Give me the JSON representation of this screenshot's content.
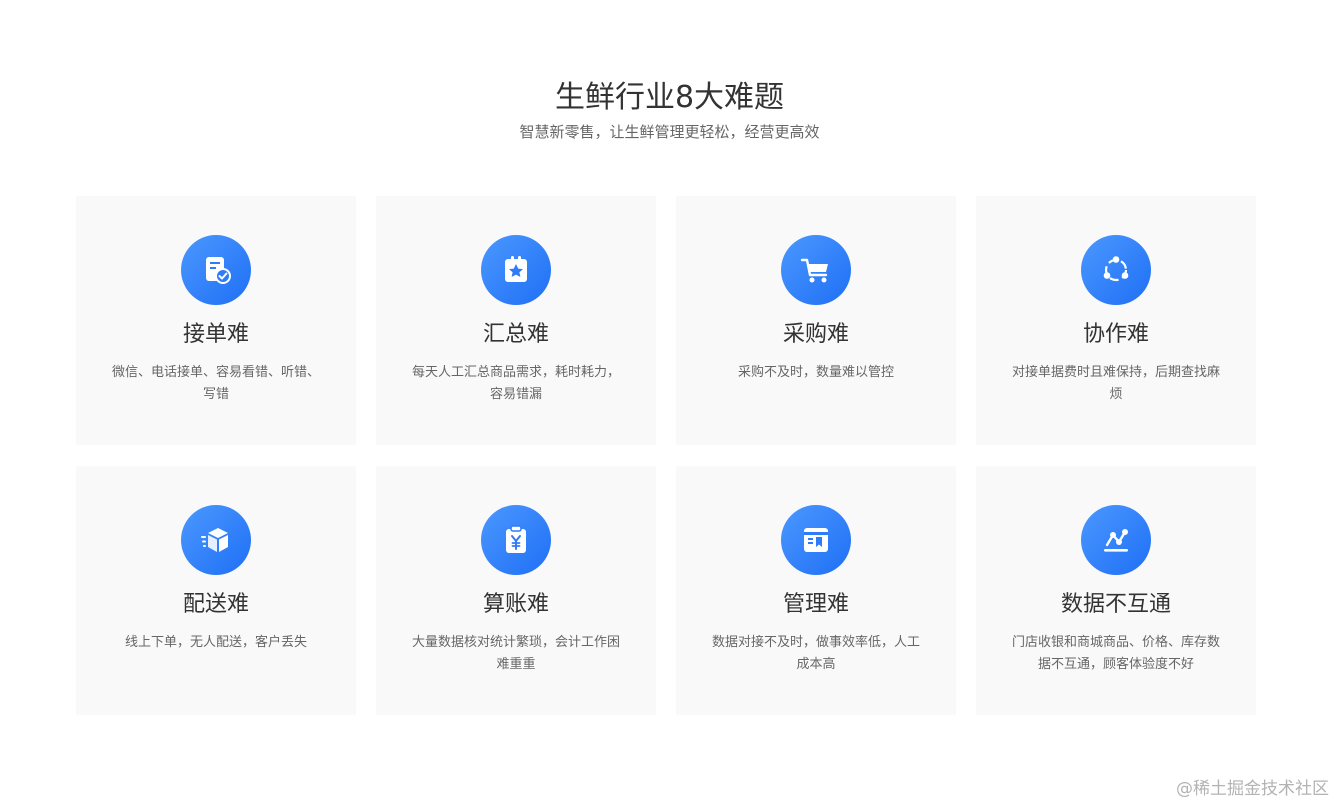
{
  "header": {
    "title": "生鲜行业8大难题",
    "subtitle": "智慧新零售，让生鲜管理更轻松，经营更高效"
  },
  "colors": {
    "accent_light": "#4b98ff",
    "accent_dark": "#1f6ff5",
    "card_background": "#f9f9f9"
  },
  "cards": [
    {
      "icon": "order-document-check-icon",
      "title": "接单难",
      "desc": "微信、电话接单、容易看错、听错、写错"
    },
    {
      "icon": "clipboard-star-icon",
      "title": "汇总难",
      "desc": "每天人工汇总商品需求，耗时耗力，容易错漏"
    },
    {
      "icon": "shopping-cart-icon",
      "title": "采购难",
      "desc": "采购不及时，数量难以管控"
    },
    {
      "icon": "collaboration-cycle-icon",
      "title": "协作难",
      "desc": "对接单据费时且难保持，后期查找麻烦"
    },
    {
      "icon": "delivery-box-icon",
      "title": "配送难",
      "desc": "线上下单，无人配送，客户丢失"
    },
    {
      "icon": "clipboard-yuan-icon",
      "title": "算账难",
      "desc": "大量数据核对统计繁琐，会计工作困难重重"
    },
    {
      "icon": "management-panel-icon",
      "title": "管理难",
      "desc": "数据对接不及时，做事效率低，人工成本高"
    },
    {
      "icon": "data-trend-icon",
      "title": "数据不互通",
      "desc": "门店收银和商城商品、价格、库存数据不互通，顾客体验度不好"
    }
  ],
  "watermark": "@稀土掘金技术社区"
}
